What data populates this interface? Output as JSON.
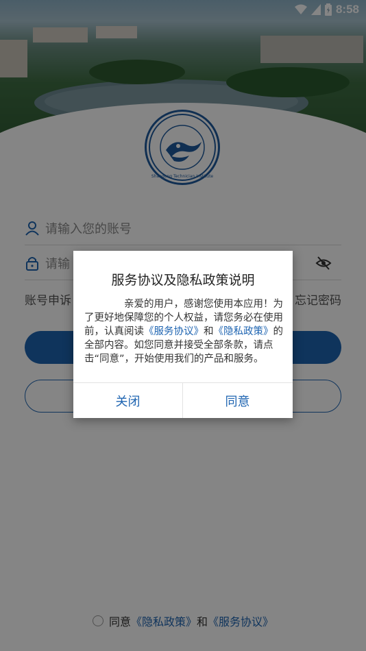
{
  "status_bar": {
    "time": "8:58"
  },
  "logo": {
    "caption": "Shandong Technician Institute"
  },
  "form": {
    "account_placeholder": "请输入您的账号",
    "password_placeholder_visible": "请输",
    "left_link_visible": "账号申诉",
    "right_link_visible": "忘记密码"
  },
  "agreement_row": {
    "prefix": "同意",
    "privacy_link": "《隐私政策》",
    "joiner": "和",
    "service_link": "《服务协议》"
  },
  "dialog": {
    "title": "服务协议及隐私政策说明",
    "text_part1": "亲爱的用户，感谢您使用本应用！为了更好地保障您的个人权益，请您务必在使用前，认真阅读",
    "service_link": "《服务协议》",
    "text_part2": "和",
    "privacy_link": "《隐私政策》",
    "text_part3": "的全部内容。如您同意并接受全部条款，请点击“同意”，开始使用我们的产品和服务。",
    "close_label": "关闭",
    "agree_label": "同意"
  },
  "colors": {
    "accent": "#1e64b1",
    "overlay": "rgba(0,0,0,0.48)"
  }
}
